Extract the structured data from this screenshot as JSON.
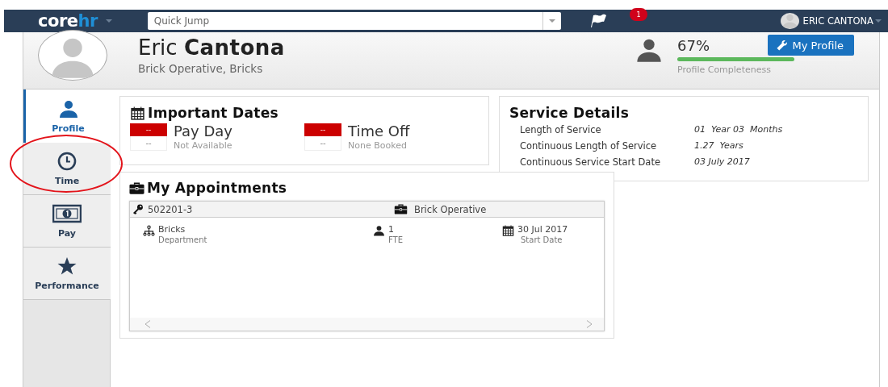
{
  "navbar": {
    "logo": {
      "part_1": "core",
      "part_2": "hr"
    },
    "quick_jump": {
      "placeholder": "Quick Jump"
    },
    "notifications": {
      "badge": "1"
    },
    "user": {
      "name": "ERIC CANTONA"
    }
  },
  "header": {
    "first_name": "Eric",
    "last_name": "Cantona",
    "subtitle": "Brick Operative, Bricks",
    "completeness": {
      "reading": "67%",
      "level": 0.67,
      "caption": "Profile Completeness"
    },
    "button": "My Profile"
  },
  "sidebar": {
    "items": [
      {
        "label": "Profile",
        "kind": "person",
        "selected": true,
        "circled": false
      },
      {
        "label": "Time",
        "kind": "clock",
        "selected": false,
        "circled": true
      },
      {
        "label": "Pay",
        "kind": "money",
        "selected": false,
        "circled": false
      },
      {
        "label": "Performance",
        "kind": "star",
        "selected": false,
        "circled": false
      }
    ]
  },
  "important_dates": {
    "title": "Important Dates",
    "items": [
      {
        "tag": "--",
        "value": "--",
        "label": "Pay Day",
        "status": "Not Available"
      },
      {
        "tag": "--",
        "value": "--",
        "label": "Time Off",
        "status": "None Booked"
      }
    ]
  },
  "service_details": {
    "title": "Service Details",
    "rows": [
      {
        "label": "Length of Service",
        "value": "01  Year 03  Months"
      },
      {
        "label": "Continuous Length of Service",
        "value": "1.27  Years"
      },
      {
        "label": "Continuous Service Start Date",
        "value": "03 July 2017"
      }
    ]
  },
  "appointments": {
    "title": "My Appointments",
    "header": {
      "id": "502201-3",
      "role": "Brick Operative"
    },
    "fields": [
      {
        "kind": "hierarchy",
        "value": "Bricks",
        "caption": "Department"
      },
      {
        "kind": "person",
        "value": "1",
        "caption": "FTE"
      },
      {
        "kind": "calendar",
        "value": "30 Jul 2017",
        "caption": "Start Date"
      }
    ]
  }
}
